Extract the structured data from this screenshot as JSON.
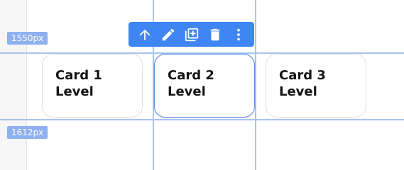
{
  "guides": {
    "top_label": "1550px",
    "bottom_label": "1612px"
  },
  "toolbar": {
    "items": [
      {
        "name": "move-up",
        "icon": "arrow-up-icon"
      },
      {
        "name": "edit",
        "icon": "pencil-icon"
      },
      {
        "name": "duplicate",
        "icon": "copy-add-icon"
      },
      {
        "name": "delete",
        "icon": "trash-icon"
      },
      {
        "name": "more",
        "icon": "more-vertical-icon"
      }
    ]
  },
  "cards": [
    {
      "title": "Card 1\nLevel",
      "selected": false
    },
    {
      "title": "Card 2\nLevel",
      "selected": true
    },
    {
      "title": "Card 3\nLevel",
      "selected": false
    }
  ],
  "colors": {
    "accent": "#3f86f4",
    "guide": "#a8c4ef",
    "label_bg": "#8fb0ee"
  }
}
